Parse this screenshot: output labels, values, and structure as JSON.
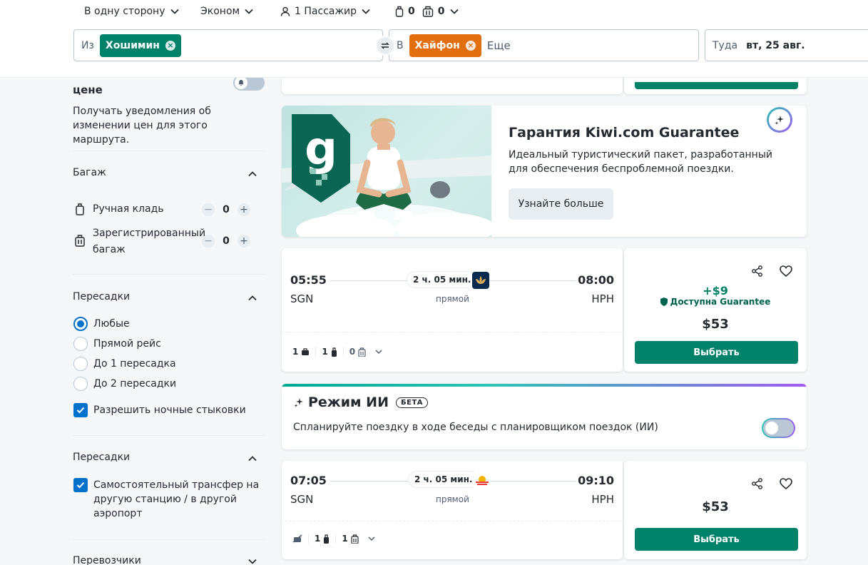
{
  "header": {
    "trip_type": "В одну сторону",
    "cabin": "Эконом",
    "passengers": "1 Пассажир",
    "cabin_bags": "0",
    "checked_bags": "0",
    "from_label": "Из",
    "from_chip": "Хошимин",
    "to_label": "В",
    "to_chip": "Хайфон",
    "more_placeholder": "Еще",
    "date_label": "Туда",
    "date_value": "вт, 25 авг."
  },
  "filters": {
    "alert_title_partial": "цене",
    "alert_desc": "Получать уведомления об изменении цен для этого маршрута.",
    "bags": {
      "title": "Багаж",
      "cabin_label": "Ручная кладь",
      "cabin_value": "0",
      "checked_label_1": "Зарегистрированный",
      "checked_label_2": "багаж",
      "checked_value": "0"
    },
    "stops": {
      "title": "Пересадки",
      "options": [
        "Любые",
        "Прямой рейс",
        "До 1 пересадка",
        "До 2 пересадки"
      ],
      "overnight": "Разрешить ночные стыковки"
    },
    "transfers": {
      "title": "Пересадки",
      "self_transfer": "Самостоятельный трансфер на другую станцию / в другой аэропорт"
    },
    "carriers_title": "Перевозчики"
  },
  "guarantee": {
    "title": "Гарантия Kiwi.com Guarantee",
    "desc": "Идеальный туристический пакет, разработанный для обеспечения беспроблемной поездки.",
    "button": "Узнайте больше"
  },
  "flights": [
    {
      "dep_time": "05:55",
      "arr_time": "08:00",
      "dep_iata": "SGN",
      "arr_iata": "HPH",
      "duration": "2 ч. 05 мин.",
      "stops": "прямой",
      "guarantee_price": "+$9",
      "guarantee_label": "Доступна Guarantee",
      "price": "$53",
      "select": "Выбрать",
      "bags": [
        "1",
        "1",
        "0"
      ]
    },
    {
      "dep_time": "07:05",
      "arr_time": "09:10",
      "dep_iata": "SGN",
      "arr_iata": "HPH",
      "duration": "2 ч. 05 мин.",
      "stops": "прямой",
      "price": "$53",
      "select": "Выбрать",
      "bags": [
        "1",
        "1"
      ]
    }
  ],
  "ai_mode": {
    "title": "Режим ИИ",
    "badge": "БЕТА",
    "desc": "Спланируйте поездку в ходе беседы с планировщиком поездок (ИИ)"
  },
  "colors": {
    "green": "#00826a",
    "orange": "#e26e0e",
    "blue": "#0172cb"
  }
}
